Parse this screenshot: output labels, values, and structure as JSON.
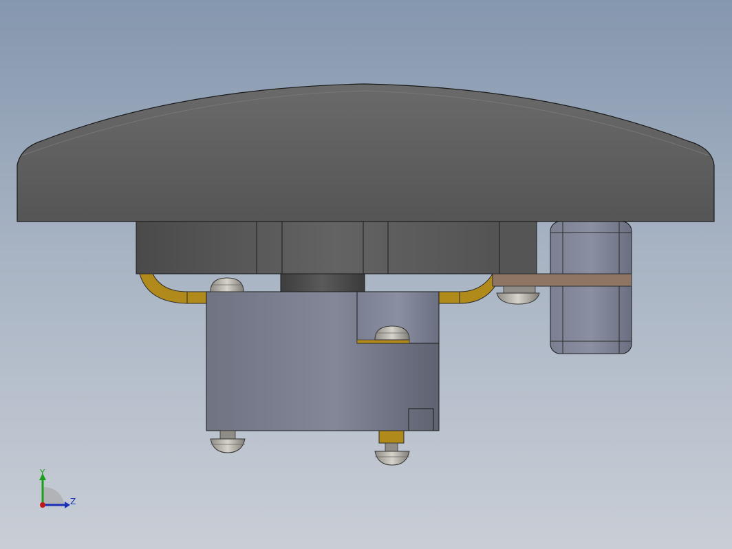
{
  "viewport": {
    "background_top": "#8597ae",
    "background_bottom": "#c9ced6"
  },
  "model": {
    "cap_color": "#5f5f5f",
    "housing_color": "#7a8090",
    "brass_color": "#b08a1a",
    "strap_color": "#8f7563",
    "screw_color": "#b9b6ae"
  },
  "triad": {
    "y_label": "Y",
    "z_label": "Z",
    "y_color": "#1aa01a",
    "z_color": "#1a2fb8",
    "x_color": "#c01818"
  }
}
